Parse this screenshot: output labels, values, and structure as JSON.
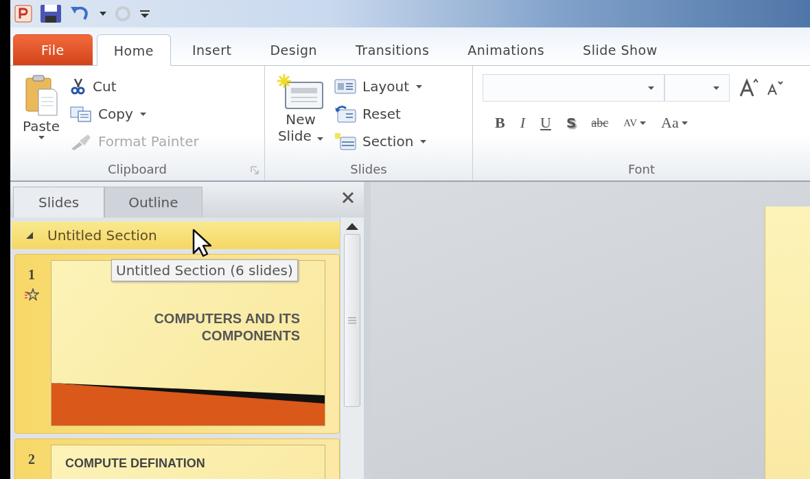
{
  "tabs": [
    {
      "label": "File",
      "kind": "file",
      "selected": false
    },
    {
      "label": "Home",
      "kind": "tab",
      "selected": true
    },
    {
      "label": "Insert",
      "kind": "tab",
      "selected": false
    },
    {
      "label": "Design",
      "kind": "tab",
      "selected": false
    },
    {
      "label": "Transitions",
      "kind": "tab",
      "selected": false
    },
    {
      "label": "Animations",
      "kind": "tab",
      "selected": false
    },
    {
      "label": "Slide Show",
      "kind": "tab",
      "selected": false
    }
  ],
  "ribbon": {
    "clipboard": {
      "label": "Clipboard",
      "paste": "Paste",
      "buttons": [
        {
          "label": "Cut",
          "kind": "cut",
          "dropdown": false,
          "disabled": false
        },
        {
          "label": "Copy",
          "kind": "copy",
          "dropdown": true,
          "disabled": false
        },
        {
          "label": "Format Painter",
          "kind": "painter",
          "dropdown": false,
          "disabled": true
        }
      ]
    },
    "slides": {
      "label": "Slides",
      "new_slide": [
        "New",
        "Slide"
      ],
      "buttons": [
        {
          "label": "Layout",
          "kind": "layout",
          "dropdown": true
        },
        {
          "label": "Reset",
          "kind": "reset",
          "dropdown": false
        },
        {
          "label": "Section",
          "kind": "section",
          "dropdown": true
        }
      ]
    },
    "font": {
      "label": "Font",
      "buttons": [
        {
          "label": "B",
          "kind": "bold",
          "dropdown": false
        },
        {
          "label": "I",
          "kind": "italic",
          "dropdown": false
        },
        {
          "label": "U",
          "kind": "underline",
          "dropdown": false
        },
        {
          "label": "S",
          "kind": "shadow",
          "dropdown": false
        },
        {
          "label": "abc",
          "kind": "strike",
          "dropdown": false
        },
        {
          "label": "AV",
          "kind": "spacing",
          "dropdown": true
        },
        {
          "label": "Aa",
          "kind": "case",
          "dropdown": true
        }
      ]
    }
  },
  "pane": {
    "tabs": [
      {
        "label": "Slides",
        "selected": true
      },
      {
        "label": "Outline",
        "selected": false
      }
    ],
    "section": {
      "title": "Untitled Section",
      "expanded": true,
      "tooltip": "Untitled Section (6 slides)"
    },
    "slides": [
      {
        "number": "1",
        "title": "COMPUTERS AND ITS COMPONENTS",
        "animated": true,
        "selected": true
      },
      {
        "number": "2",
        "title": "COMPUTE  DEFINATION",
        "animated": false,
        "selected": true
      }
    ]
  }
}
